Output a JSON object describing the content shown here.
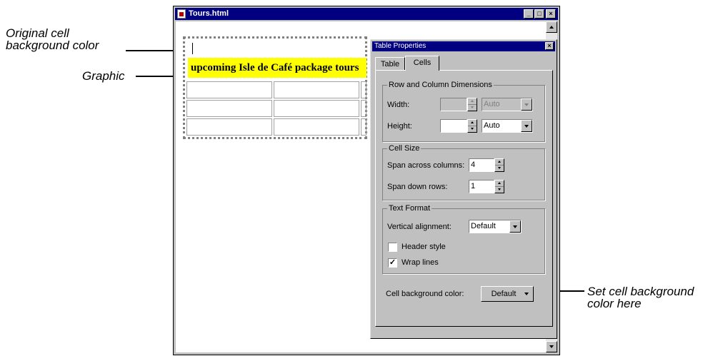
{
  "callouts": {
    "original_cell_bg": "Original cell\nbackground color",
    "graphic": "Graphic",
    "set_cell_bg": "Set cell background\ncolor here"
  },
  "window": {
    "title": "Tours.html",
    "banner_text": "upcoming Isle de Café package tours"
  },
  "dialog": {
    "title": "Table Properties",
    "tabs": [
      "Table",
      "Cells"
    ],
    "active_tab": "Cells",
    "row_col": {
      "title": "Row and Column Dimensions",
      "width_label": "Width:",
      "width_value": "",
      "width_unit": "Auto",
      "height_label": "Height:",
      "height_value": "",
      "height_unit": "Auto"
    },
    "cell_size": {
      "title": "Cell Size",
      "span_cols_label": "Span across columns:",
      "span_cols_value": "4",
      "span_rows_label": "Span down rows:",
      "span_rows_value": "1"
    },
    "text_format": {
      "title": "Text Format",
      "valign_label": "Vertical alignment:",
      "valign_value": "Default",
      "header_style_label": "Header style",
      "header_style_checked": false,
      "wrap_lines_label": "Wrap lines",
      "wrap_lines_checked": true
    },
    "cell_bg": {
      "label": "Cell background color:",
      "value": "Default"
    }
  },
  "colors": {
    "titlebar": "#000080",
    "banner_bg": "#ffff00",
    "dialog_bg": "#c0c0c0"
  }
}
